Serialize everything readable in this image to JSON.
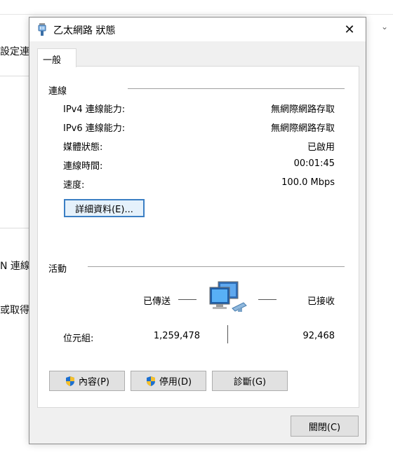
{
  "background": {
    "text_1": "設定連",
    "text_2": "N 連線",
    "text_3": "或取得",
    "chevron": "⌄"
  },
  "dialog": {
    "title": "乙太網路 狀態",
    "icon": "ethernet-plug-icon",
    "close_glyph": "✕",
    "tab_label": "一般",
    "connection": {
      "group_label": "連線",
      "rows": [
        {
          "label": "IPv4 連線能力:",
          "value": "無網際網路存取"
        },
        {
          "label": "IPv6 連線能力:",
          "value": "無網際網路存取"
        },
        {
          "label": "媒體狀態:",
          "value": "已啟用"
        },
        {
          "label": "連線時間:",
          "value": "00:01:45"
        },
        {
          "label": "速度:",
          "value": "100.0 Mbps"
        }
      ],
      "details_button": "詳細資料(E)..."
    },
    "activity": {
      "group_label": "活動",
      "sent_label": "已傳送",
      "received_label": "已接收",
      "bytes_label": "位元組:",
      "bytes_sent": "1,259,478",
      "bytes_received": "92,468",
      "icon": "network-computers-icon"
    },
    "buttons": {
      "properties": "內容(P)",
      "disable": "停用(D)",
      "diagnose": "診斷(G)",
      "close": "關閉(C)"
    }
  }
}
